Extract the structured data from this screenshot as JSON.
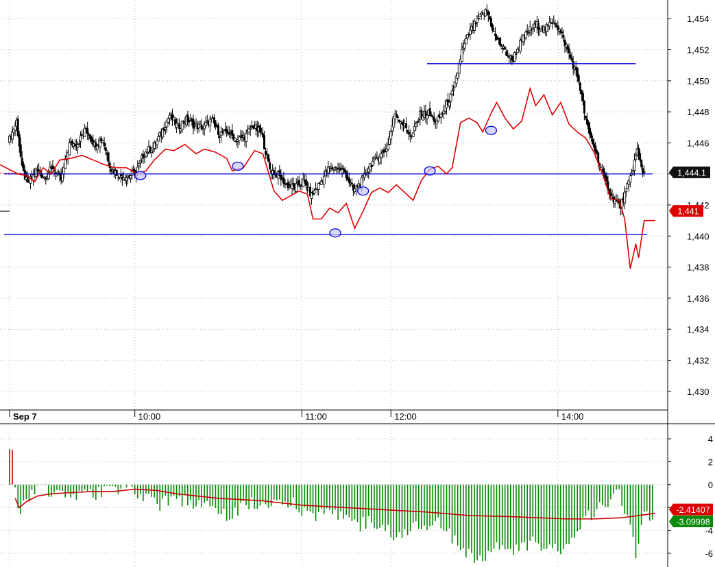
{
  "chart_data": [
    {
      "type": "candlestick",
      "panel": "price",
      "y_ticks": [
        "1,430",
        "1,432",
        "1,434",
        "1,436",
        "1,438",
        "1,440",
        "1,442",
        "1,444",
        "1,446",
        "1,448",
        "1,450",
        "1,452",
        "1,454"
      ],
      "ylim": [
        1428.8,
        1455.2
      ],
      "x_labels": [
        {
          "label": "Sep 7",
          "bar": 0
        },
        {
          "label": "10:00",
          "bar": 90
        },
        {
          "label": "11:00",
          "bar": 210
        },
        {
          "label": "12:00",
          "bar": 274
        },
        {
          "label": "14:00",
          "bar": 394
        }
      ],
      "last_price_label": "1,444.1",
      "last_price": 1444.1,
      "ma_label": "1,441",
      "ma_value": 1441.0,
      "horizontal_lines": [
        {
          "y": 1444.0,
          "from_bar": 0,
          "to_bar": 462
        },
        {
          "y": 1440.1,
          "from_bar": 0,
          "to_bar": 458
        },
        {
          "y": 1451.1,
          "from_bar": 300,
          "to_bar": 450
        }
      ],
      "close_path": [
        [
          0,
          1446.0
        ],
        [
          6,
          1447.4
        ],
        [
          10,
          1444.3
        ],
        [
          14,
          1443.3
        ],
        [
          20,
          1444.2
        ],
        [
          26,
          1443.8
        ],
        [
          32,
          1444.4
        ],
        [
          38,
          1443.6
        ],
        [
          44,
          1445.9
        ],
        [
          50,
          1446.0
        ],
        [
          56,
          1446.9
        ],
        [
          62,
          1445.9
        ],
        [
          68,
          1446.2
        ],
        [
          74,
          1444.3
        ],
        [
          80,
          1443.9
        ],
        [
          86,
          1443.8
        ],
        [
          92,
          1444.1
        ],
        [
          98,
          1445.4
        ],
        [
          104,
          1445.7
        ],
        [
          110,
          1446.6
        ],
        [
          116,
          1447.8
        ],
        [
          122,
          1447.0
        ],
        [
          128,
          1447.5
        ],
        [
          134,
          1447.1
        ],
        [
          140,
          1447.0
        ],
        [
          146,
          1447.5
        ],
        [
          152,
          1446.6
        ],
        [
          158,
          1446.7
        ],
        [
          164,
          1446.2
        ],
        [
          170,
          1446.4
        ],
        [
          176,
          1447.1
        ],
        [
          182,
          1446.6
        ],
        [
          188,
          1444.3
        ],
        [
          194,
          1443.9
        ],
        [
          200,
          1443.3
        ],
        [
          206,
          1443.1
        ],
        [
          212,
          1443.5
        ],
        [
          218,
          1442.6
        ],
        [
          224,
          1443.4
        ],
        [
          230,
          1444.3
        ],
        [
          236,
          1444.4
        ],
        [
          242,
          1444.1
        ],
        [
          248,
          1442.9
        ],
        [
          254,
          1443.5
        ],
        [
          260,
          1444.6
        ],
        [
          266,
          1445.1
        ],
        [
          272,
          1445.6
        ],
        [
          278,
          1447.9
        ],
        [
          284,
          1447.2
        ],
        [
          290,
          1446.4
        ],
        [
          296,
          1447.8
        ],
        [
          302,
          1447.9
        ],
        [
          308,
          1447.3
        ],
        [
          314,
          1448.3
        ],
        [
          320,
          1449.3
        ],
        [
          326,
          1451.9
        ],
        [
          332,
          1453.2
        ],
        [
          338,
          1454.0
        ],
        [
          344,
          1454.5
        ],
        [
          350,
          1452.8
        ],
        [
          356,
          1452.0
        ],
        [
          362,
          1451.3
        ],
        [
          368,
          1452.4
        ],
        [
          374,
          1453.2
        ],
        [
          380,
          1453.6
        ],
        [
          386,
          1453.3
        ],
        [
          392,
          1453.9
        ],
        [
          398,
          1452.9
        ],
        [
          404,
          1451.5
        ],
        [
          410,
          1450.0
        ],
        [
          416,
          1447.0
        ],
        [
          422,
          1445.5
        ],
        [
          428,
          1443.8
        ],
        [
          434,
          1442.5
        ],
        [
          440,
          1441.9
        ],
        [
          446,
          1443.4
        ],
        [
          452,
          1445.5
        ],
        [
          456,
          1444.1
        ]
      ],
      "ma_path": [
        [
          0,
          1444.6
        ],
        [
          6,
          1444.0
        ],
        [
          12,
          1443.9
        ],
        [
          18,
          1443.5
        ],
        [
          24,
          1444.4
        ],
        [
          30,
          1444.0
        ],
        [
          36,
          1444.9
        ],
        [
          44,
          1445.0
        ],
        [
          52,
          1445.2
        ],
        [
          60,
          1444.9
        ],
        [
          68,
          1444.6
        ],
        [
          76,
          1444.4
        ],
        [
          84,
          1444.4
        ],
        [
          92,
          1444.0
        ],
        [
          98,
          1444.2
        ],
        [
          104,
          1444.9
        ],
        [
          112,
          1445.6
        ],
        [
          118,
          1445.5
        ],
        [
          126,
          1445.9
        ],
        [
          134,
          1445.3
        ],
        [
          140,
          1445.6
        ],
        [
          148,
          1445.4
        ],
        [
          156,
          1445.0
        ],
        [
          160,
          1444.2
        ],
        [
          168,
          1444.4
        ],
        [
          176,
          1445.5
        ],
        [
          182,
          1445.3
        ],
        [
          190,
          1442.9
        ],
        [
          196,
          1442.3
        ],
        [
          202,
          1442.6
        ],
        [
          208,
          1442.9
        ],
        [
          214,
          1442.7
        ],
        [
          218,
          1441.1
        ],
        [
          224,
          1441.1
        ],
        [
          230,
          1441.8
        ],
        [
          236,
          1441.5
        ],
        [
          242,
          1442.1
        ],
        [
          248,
          1440.5
        ],
        [
          254,
          1441.6
        ],
        [
          260,
          1442.8
        ],
        [
          266,
          1443.1
        ],
        [
          272,
          1442.8
        ],
        [
          278,
          1443.3
        ],
        [
          284,
          1442.8
        ],
        [
          290,
          1442.3
        ],
        [
          296,
          1443.6
        ],
        [
          302,
          1444.3
        ],
        [
          308,
          1444.5
        ],
        [
          314,
          1444.0
        ],
        [
          318,
          1444.4
        ],
        [
          324,
          1447.3
        ],
        [
          330,
          1447.6
        ],
        [
          336,
          1447.3
        ],
        [
          340,
          1446.7
        ],
        [
          346,
          1447.9
        ],
        [
          350,
          1448.6
        ],
        [
          356,
          1447.6
        ],
        [
          362,
          1446.9
        ],
        [
          368,
          1447.4
        ],
        [
          374,
          1449.5
        ],
        [
          378,
          1448.4
        ],
        [
          384,
          1449.1
        ],
        [
          390,
          1447.8
        ],
        [
          396,
          1448.6
        ],
        [
          402,
          1447.2
        ],
        [
          408,
          1446.7
        ],
        [
          414,
          1446.3
        ],
        [
          420,
          1445.4
        ],
        [
          426,
          1444.0
        ],
        [
          432,
          1442.4
        ],
        [
          438,
          1442.3
        ],
        [
          442,
          1441.1
        ],
        [
          446,
          1437.9
        ],
        [
          450,
          1439.5
        ],
        [
          452,
          1438.6
        ],
        [
          456,
          1441.0
        ],
        [
          464,
          1441.0
        ]
      ],
      "circle_markers": [
        {
          "bar": 94,
          "y": 1443.9
        },
        {
          "bar": 164,
          "y": 1444.5
        },
        {
          "bar": 234,
          "y": 1440.2
        },
        {
          "bar": 254,
          "y": 1442.9
        },
        {
          "bar": 302,
          "y": 1444.2
        },
        {
          "bar": 346,
          "y": 1446.8
        }
      ]
    },
    {
      "type": "bar",
      "panel": "oscillator",
      "y_ticks": [
        "-6",
        "-4",
        "-2",
        "0",
        "2",
        "4"
      ],
      "ylim": [
        -7.2,
        5.2
      ],
      "histogram_path": [
        [
          0,
          3.1
        ],
        [
          3,
          3.0
        ],
        [
          4,
          -0.4
        ],
        [
          6,
          -1.8
        ],
        [
          8,
          -2.6
        ],
        [
          10,
          -1.6
        ],
        [
          14,
          -1.2
        ],
        [
          18,
          -0.6
        ],
        [
          24,
          0.2
        ],
        [
          30,
          -0.8
        ],
        [
          36,
          -0.6
        ],
        [
          42,
          -1.0
        ],
        [
          48,
          -1.2
        ],
        [
          54,
          -0.6
        ],
        [
          60,
          -1.0
        ],
        [
          66,
          -0.6
        ],
        [
          72,
          0.4
        ],
        [
          78,
          -0.4
        ],
        [
          84,
          0.6
        ],
        [
          90,
          -0.8
        ],
        [
          96,
          -1.0
        ],
        [
          102,
          -0.7
        ],
        [
          108,
          -1.8
        ],
        [
          114,
          -1.3
        ],
        [
          120,
          -1.0
        ],
        [
          126,
          -1.5
        ],
        [
          132,
          -1.6
        ],
        [
          138,
          -1.9
        ],
        [
          144,
          -2.0
        ],
        [
          150,
          -2.3
        ],
        [
          156,
          -2.8
        ],
        [
          162,
          -2.4
        ],
        [
          168,
          -2.0
        ],
        [
          174,
          -1.5
        ],
        [
          180,
          -2.1
        ],
        [
          186,
          -1.6
        ],
        [
          192,
          -1.3
        ],
        [
          198,
          -1.9
        ],
        [
          204,
          -1.5
        ],
        [
          210,
          -2.4
        ],
        [
          216,
          -2.8
        ],
        [
          222,
          -2.5
        ],
        [
          228,
          -2.0
        ],
        [
          234,
          -2.6
        ],
        [
          240,
          -3.0
        ],
        [
          246,
          -2.9
        ],
        [
          252,
          -3.5
        ],
        [
          258,
          -3.2
        ],
        [
          264,
          -3.8
        ],
        [
          270,
          -3.6
        ],
        [
          276,
          -4.3
        ],
        [
          282,
          -4.5
        ],
        [
          288,
          -3.8
        ],
        [
          294,
          -3.6
        ],
        [
          300,
          -4.0
        ],
        [
          306,
          -3.3
        ],
        [
          312,
          -3.6
        ],
        [
          318,
          -4.6
        ],
        [
          324,
          -5.6
        ],
        [
          330,
          -6.1
        ],
        [
          336,
          -6.8
        ],
        [
          342,
          -6.3
        ],
        [
          348,
          -5.8
        ],
        [
          354,
          -5.1
        ],
        [
          360,
          -5.5
        ],
        [
          366,
          -5.8
        ],
        [
          372,
          -5.3
        ],
        [
          378,
          -4.8
        ],
        [
          384,
          -5.6
        ],
        [
          390,
          -5.2
        ],
        [
          396,
          -5.9
        ],
        [
          402,
          -4.8
        ],
        [
          408,
          -3.8
        ],
        [
          414,
          -2.9
        ],
        [
          420,
          -2.7
        ],
        [
          426,
          -1.6
        ],
        [
          432,
          -1.3
        ],
        [
          438,
          -0.9
        ],
        [
          444,
          -3.2
        ],
        [
          450,
          -5.9
        ],
        [
          456,
          -2.5
        ],
        [
          464,
          -3.1
        ]
      ],
      "signal_path": [
        [
          4,
          -1.2
        ],
        [
          7,
          -2.0
        ],
        [
          12,
          -1.5
        ],
        [
          20,
          -1.0
        ],
        [
          30,
          -0.8
        ],
        [
          45,
          -0.7
        ],
        [
          60,
          -0.6
        ],
        [
          75,
          -0.6
        ],
        [
          90,
          -0.4
        ],
        [
          105,
          -0.5
        ],
        [
          120,
          -0.8
        ],
        [
          150,
          -1.2
        ],
        [
          180,
          -1.4
        ],
        [
          210,
          -1.8
        ],
        [
          240,
          -2.0
        ],
        [
          270,
          -2.2
        ],
        [
          300,
          -2.4
        ],
        [
          330,
          -2.7
        ],
        [
          360,
          -2.8
        ],
        [
          380,
          -2.9
        ],
        [
          400,
          -3.0
        ],
        [
          420,
          -3.0
        ],
        [
          440,
          -2.9
        ],
        [
          464,
          -2.5
        ]
      ],
      "signal_label": "-2.41407",
      "signal_value": -2.41407,
      "histogram_label": "-3.09998",
      "histogram_value": -3.09998
    }
  ],
  "colors": {
    "candle": "#000000",
    "ma_line": "#e00000",
    "level_line": "#0000dd",
    "marker_fill": "#c8c8ff",
    "histogram_positive": "#d00000",
    "histogram_negative": "#008800",
    "signal_line": "#cc0000",
    "price_tag_bg": "#111111",
    "ma_tag_bg": "#dd0000",
    "histogram_tag_bg": "#0a8a0a",
    "grid": "#b4b4b4"
  }
}
